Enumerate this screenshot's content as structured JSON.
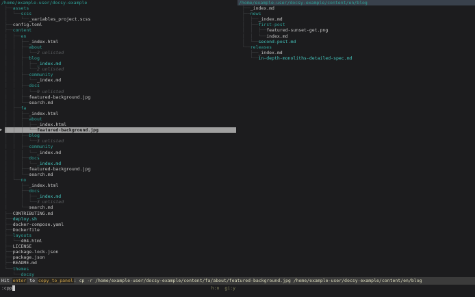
{
  "colors": {
    "bg": "#1c1c1e",
    "directory": "#2fa198",
    "special_file": "#45c8c0",
    "file": "#c8c8c8",
    "selection_bg": "#a0a0a0",
    "hint_key": "#cfa349",
    "header_bg": "#39414c"
  },
  "left_panel": {
    "root_path": "/home/example-user/docsy-example",
    "rows": [
      {
        "prefix": "├──",
        "name": "assets",
        "type": "dir"
      },
      {
        "prefix": "│  └──",
        "name": "scss",
        "type": "dir"
      },
      {
        "prefix": "│     └──",
        "name": "_variables_project.scss",
        "type": "file"
      },
      {
        "prefix": "├──",
        "name": "config.toml",
        "type": "file"
      },
      {
        "prefix": "├──",
        "name": "content",
        "type": "dir"
      },
      {
        "prefix": "│  ├──",
        "name": "en",
        "type": "dir"
      },
      {
        "prefix": "│  │  ├──",
        "name": "_index.html",
        "type": "file"
      },
      {
        "prefix": "│  │  ├──",
        "name": "about",
        "type": "dir"
      },
      {
        "prefix": "│  │  │  └──",
        "name": "2 unlisted",
        "type": "unlisted"
      },
      {
        "prefix": "│  │  ├──",
        "name": "blog",
        "type": "dir"
      },
      {
        "prefix": "│  │  │  ├──",
        "name": "_index.md",
        "type": "special"
      },
      {
        "prefix": "│  │  │  └──",
        "name": "2 unlisted",
        "type": "unlisted"
      },
      {
        "prefix": "│  │  ├──",
        "name": "community",
        "type": "dir"
      },
      {
        "prefix": "│  │  │  └──",
        "name": "_index.md",
        "type": "file"
      },
      {
        "prefix": "│  │  ├──",
        "name": "docs",
        "type": "dir"
      },
      {
        "prefix": "│  │  │  └──",
        "name": "9 unlisted",
        "type": "unlisted"
      },
      {
        "prefix": "│  │  ├──",
        "name": "featured-background.jpg",
        "type": "file"
      },
      {
        "prefix": "│  │  └──",
        "name": "search.md",
        "type": "file"
      },
      {
        "prefix": "│  ├──",
        "name": "fa",
        "type": "dir"
      },
      {
        "prefix": "│  │  ├──",
        "name": "_index.html",
        "type": "file"
      },
      {
        "prefix": "│  │  ├──",
        "name": "about",
        "type": "dir"
      },
      {
        "prefix": "│  │  │  ├──",
        "name": "_index.html",
        "type": "file"
      },
      {
        "prefix": "│  │  │  └──",
        "name": "featured-background.jpg",
        "type": "file",
        "selected": true
      },
      {
        "prefix": "│  │  ├──",
        "name": "blog",
        "type": "dir"
      },
      {
        "prefix": "│  │  │  └──",
        "name": "3 unlisted",
        "type": "unlisted"
      },
      {
        "prefix": "│  │  ├──",
        "name": "community",
        "type": "dir"
      },
      {
        "prefix": "│  │  │  └──",
        "name": "_index.md",
        "type": "file"
      },
      {
        "prefix": "│  │  ├──",
        "name": "docs",
        "type": "dir"
      },
      {
        "prefix": "│  │  │  └──",
        "name": "_index.md",
        "type": "special"
      },
      {
        "prefix": "│  │  ├──",
        "name": "featured-background.jpg",
        "type": "file"
      },
      {
        "prefix": "│  │  └──",
        "name": "search.md",
        "type": "file"
      },
      {
        "prefix": "│  └──",
        "name": "no",
        "type": "dir"
      },
      {
        "prefix": "│     ├──",
        "name": "_index.html",
        "type": "file"
      },
      {
        "prefix": "│     ├──",
        "name": "docs",
        "type": "dir"
      },
      {
        "prefix": "│     │  ├──",
        "name": "_index.md",
        "type": "special"
      },
      {
        "prefix": "│     │  └──",
        "name": "3 unlisted",
        "type": "unlisted"
      },
      {
        "prefix": "│     └──",
        "name": "search.md",
        "type": "file"
      },
      {
        "prefix": "├──",
        "name": "CONTRIBUTING.md",
        "type": "file"
      },
      {
        "prefix": "├──",
        "name": "deploy.sh",
        "type": "special"
      },
      {
        "prefix": "├──",
        "name": "docker-compose.yaml",
        "type": "file"
      },
      {
        "prefix": "├──",
        "name": "Dockerfile",
        "type": "file"
      },
      {
        "prefix": "├──",
        "name": "layouts",
        "type": "dir"
      },
      {
        "prefix": "│  └──",
        "name": "404.html",
        "type": "file"
      },
      {
        "prefix": "├──",
        "name": "LICENSE",
        "type": "file"
      },
      {
        "prefix": "├──",
        "name": "package-lock.json",
        "type": "file"
      },
      {
        "prefix": "├──",
        "name": "package.json",
        "type": "file"
      },
      {
        "prefix": "├──",
        "name": "README.md",
        "type": "file"
      },
      {
        "prefix": "└──",
        "name": "themes",
        "type": "dir"
      },
      {
        "prefix": "   └──",
        "name": "docsy",
        "type": "dir"
      }
    ]
  },
  "right_panel": {
    "root_path": "/home/example-user/docsy-example/content/en/blog",
    "rows": [
      {
        "prefix": "├──",
        "name": "_index.md",
        "type": "file"
      },
      {
        "prefix": "├──",
        "name": "news",
        "type": "dir"
      },
      {
        "prefix": "│  ├──",
        "name": "_index.md",
        "type": "file"
      },
      {
        "prefix": "│  ├──",
        "name": "first-post",
        "type": "dir"
      },
      {
        "prefix": "│  │  ├──",
        "name": "featured-sunset-get.png",
        "type": "file"
      },
      {
        "prefix": "│  │  └──",
        "name": "index.md",
        "type": "file"
      },
      {
        "prefix": "│  └──",
        "name": "second-post.md",
        "type": "special"
      },
      {
        "prefix": "└──",
        "name": "releases",
        "type": "dir"
      },
      {
        "prefix": "   ├──",
        "name": "_index.md",
        "type": "file"
      },
      {
        "prefix": "   └──",
        "name": "in-depth-monoliths-detailed-spec.md",
        "type": "special"
      }
    ]
  },
  "status_bar": {
    "hint_prefix": "Hit",
    "key": "enter",
    "hint_mid": "to",
    "verb": "copy_to_panel",
    "command": ": cp -r /home/example-user/docsy-example/content/fa/about/featured-background.jpg /home/example-user/docsy-example/content/en/blog"
  },
  "command_input": {
    "value": ":cpp",
    "flags": "h:n  gi:y"
  },
  "selection_marker_icon": "▶"
}
